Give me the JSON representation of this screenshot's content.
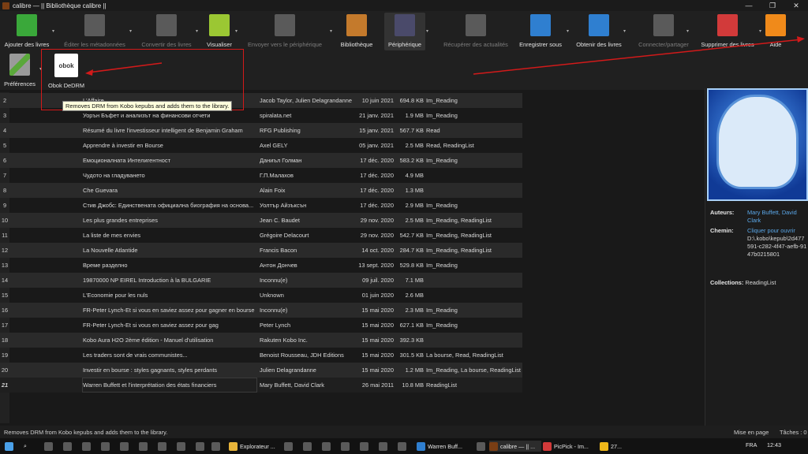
{
  "window": {
    "title": "calibre — || Bibliothèque calibre ||",
    "minimize": "—",
    "maximize": "❐",
    "close": "✕"
  },
  "toolbar": [
    {
      "label": "Ajouter des livres",
      "icon": "add-books-icon",
      "color": "#3aa83a",
      "disabled": false
    },
    {
      "label": "Éditer les métadonnées",
      "icon": "edit-metadata-icon",
      "color": "#8a8a8a",
      "disabled": true
    },
    {
      "label": "Convertir des livres",
      "icon": "convert-books-icon",
      "color": "#8a8a8a",
      "disabled": true
    },
    {
      "label": "Visualiser",
      "icon": "view-icon",
      "color": "#9bc733",
      "disabled": false
    },
    {
      "label": "Envoyer vers le périphérique",
      "icon": "send-to-device-icon",
      "color": "#8a8a8a",
      "disabled": true
    },
    {
      "label": "Bibliothèque",
      "icon": "library-icon",
      "color": "#c47a2c",
      "disabled": false
    },
    {
      "label": "Périphérique",
      "icon": "device-icon",
      "color": "#4a4a6a",
      "disabled": false,
      "active": true
    },
    {
      "label": "Récupérer des actualités",
      "icon": "fetch-news-icon",
      "color": "#8a8a8a",
      "disabled": true
    },
    {
      "label": "Enregistrer sous",
      "icon": "save-to-disk-icon",
      "color": "#2f7fd0",
      "disabled": false
    },
    {
      "label": "Obtenir des livres",
      "icon": "get-books-icon",
      "color": "#2f7fd0",
      "disabled": false
    },
    {
      "label": "Connecter/partager",
      "icon": "connect-share-icon",
      "color": "#8a8a8a",
      "disabled": true
    },
    {
      "label": "Supprimer des livres",
      "icon": "remove-books-icon",
      "color": "#d23a3a",
      "disabled": false
    },
    {
      "label": "Aide",
      "icon": "help-icon",
      "color": "#f08a1a",
      "disabled": false
    }
  ],
  "toolbar2": [
    {
      "label": "Préférences",
      "icon": "preferences-icon"
    },
    {
      "label": "Obok DeDRM",
      "icon": "obok-icon",
      "icon_text": "obok"
    }
  ],
  "tooltip": "Removes DRM from Kobo kepubs and adds them to the library.",
  "books": [
    {
      "num": "2",
      "title": "L'Affaire...",
      "author": "Jacob Taylor, Julien Delagrandanne",
      "date": "10 juin 2021",
      "size": "694.8 KB",
      "tags": "Im_Reading"
    },
    {
      "num": "3",
      "title": "Уорън Бъфет и анализът на финансови отчети",
      "author": "spiralata.net",
      "date": "21 janv. 2021",
      "size": "1.9 MB",
      "tags": "Im_Reading"
    },
    {
      "num": "4",
      "title": "Résumé du livre l'investisseur intelligent de Benjamin Graham",
      "author": "RFG Publishing",
      "date": "15 janv. 2021",
      "size": "567.7 KB",
      "tags": "Read"
    },
    {
      "num": "5",
      "title": "Apprendre à investir en Bourse",
      "author": "Axel GELY",
      "date": "05 janv. 2021",
      "size": "2.5 MB",
      "tags": "Read, ReadingList"
    },
    {
      "num": "6",
      "title": "Емоционалната Интелигентност",
      "author": "Даниъл Голман",
      "date": "17 déc. 2020",
      "size": "583.2 KB",
      "tags": "Im_Reading"
    },
    {
      "num": "7",
      "title": "Чудото на гладуването",
      "author": "Г.П.Малахов",
      "date": "17 déc. 2020",
      "size": "4.9 MB",
      "tags": ""
    },
    {
      "num": "8",
      "title": "Che Guevara",
      "author": "Alain Foix",
      "date": "17 déc. 2020",
      "size": "1.3 MB",
      "tags": ""
    },
    {
      "num": "9",
      "title": "Стив Джобс: Единствената официална биография на основа...",
      "author": "Уолтър Айзъксън",
      "date": "17 déc. 2020",
      "size": "2.9 MB",
      "tags": "Im_Reading"
    },
    {
      "num": "10",
      "title": "Les plus grandes entreprises",
      "author": "Jean C. Baudet",
      "date": "29 nov. 2020",
      "size": "2.5 MB",
      "tags": "Im_Reading, ReadingList"
    },
    {
      "num": "11",
      "title": "La liste de mes envies",
      "author": "Grégoire Delacourt",
      "date": "29 nov. 2020",
      "size": "542.7 KB",
      "tags": "Im_Reading, ReadingList"
    },
    {
      "num": "12",
      "title": "La Nouvelle Atlantide",
      "author": "Francis Bacon",
      "date": "14 oct. 2020",
      "size": "284.7 KB",
      "tags": "Im_Reading, ReadingList"
    },
    {
      "num": "13",
      "title": "Време разделно",
      "author": "Антон Дончев",
      "date": "13 sept. 2020",
      "size": "529.8 KB",
      "tags": "Im_Reading"
    },
    {
      "num": "14",
      "title": "19870000 NP EIREL Introduction à la BULGARIE",
      "author": "Inconnu(e)",
      "date": "09 juil. 2020",
      "size": "7.1 MB",
      "tags": ""
    },
    {
      "num": "15",
      "title": "L'Economie pour les nuls",
      "author": "Unknown",
      "date": "01 juin 2020",
      "size": "2.6 MB",
      "tags": ""
    },
    {
      "num": "16",
      "title": "FR-Peter Lynch-Et si vous en saviez assez pour gagner en bourse",
      "author": "Inconnu(e)",
      "date": "15 mai 2020",
      "size": "2.3 MB",
      "tags": "Im_Reading"
    },
    {
      "num": "17",
      "title": "FR-Peter Lynch-Et si vous en saviez assez pour gag",
      "author": "Peter Lynch",
      "date": "15 mai 2020",
      "size": "627.1 KB",
      "tags": "Im_Reading"
    },
    {
      "num": "18",
      "title": "Kobo Aura H2O 2ème édition - Manuel d'utilisation",
      "author": "Rakuten Kobo Inc.",
      "date": "15 mai 2020",
      "size": "392.3 KB",
      "tags": ""
    },
    {
      "num": "19",
      "title": "Les traders sont de vrais communistes...",
      "author": "Benoist Rousseau, JDH Editions",
      "date": "15 mai 2020",
      "size": "301.5 KB",
      "tags": "La bourse, Read, ReadingList"
    },
    {
      "num": "20",
      "title": "Investir en bourse : styles gagnants, styles perdants",
      "author": "Julien Delagrandanne",
      "date": "15 mai 2020",
      "size": "1.2 MB",
      "tags": "Im_Reading, La bourse, ReadingList"
    },
    {
      "num": "21",
      "title": "Warren Buffett et l'interprétation des états financiers",
      "author": "Mary Buffett, David Clark",
      "date": "26 mai 2011",
      "size": "10.8 MB",
      "tags": "ReadingList",
      "selected": true
    }
  ],
  "details": {
    "authors_label": "Auteurs:",
    "authors_value": "Mary Buffett, David Clark",
    "path_label": "Chemin:",
    "path_link": "Cliquer pour ouvrir",
    "path_value": "D:\\.kobo\\kepub\\2d477591-c282-4f47-aefb-9147b0215801",
    "collections_label": "Collections:",
    "collections_value": "ReadingList"
  },
  "status": {
    "left": "Removes DRM from Kobo kepubs and adds them to the library.",
    "layout": "Mise en page",
    "jobs": "Tâches : 0"
  },
  "taskbar": {
    "items": [
      {
        "label": "Explorateur ...",
        "color": "#e8b43a"
      },
      {
        "label": "Warren Buff...",
        "color": "#2f7fd0"
      },
      {
        "label": "calibre — || ...",
        "color": "#7a3e14",
        "active": true
      },
      {
        "label": "PicPick - Im...",
        "color": "#d23a3a"
      },
      {
        "label": "27...",
        "color": "#f0b81a"
      }
    ],
    "lang": "FRA",
    "time": "12:43"
  },
  "colors": {
    "accent_link": "#5aa7e8",
    "callout_red": "#d21a1a"
  }
}
